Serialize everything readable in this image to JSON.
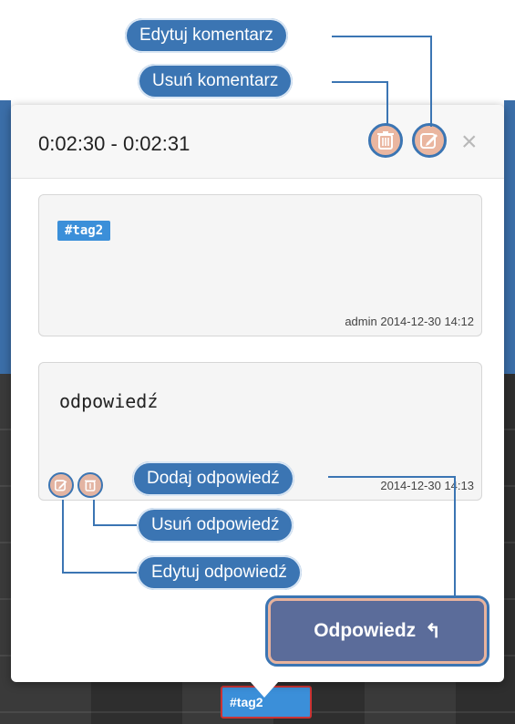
{
  "header": {
    "time_range": "0:02:30 - 0:02:31",
    "close_glyph": "×"
  },
  "comment": {
    "tag": "#tag2",
    "meta": "admin 2014-12-30 14:12"
  },
  "reply": {
    "text": "odpowiedź",
    "meta": "2014-12-30 14:13"
  },
  "reply_button": {
    "label": "Odpowiedz",
    "icon": "reply-arrow-icon",
    "glyph": "↰"
  },
  "timeline_tag": "#tag2",
  "callouts": {
    "edit_comment": "Edytuj komentarz",
    "delete_comment": "Usuń komentarz",
    "add_reply": "Dodaj odpowiedź",
    "delete_reply": "Usuń odpowiedź",
    "edit_reply": "Edytuj odpowiedź"
  },
  "colors": {
    "callout": "#3b75b3",
    "tag": "#3b8fd9",
    "reply_button": "#5b6c9a",
    "icon_button": "#eab6a0"
  },
  "icons": {
    "delete": "trash-icon",
    "edit": "pencil-icon",
    "close": "close-icon"
  }
}
